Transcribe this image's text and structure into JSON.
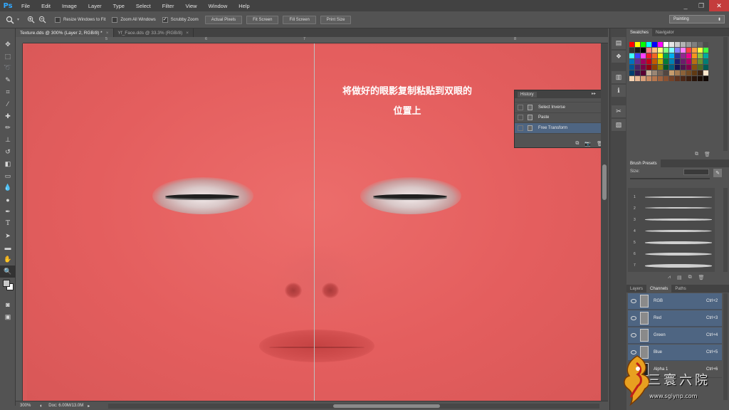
{
  "app": {
    "logo": "Ps"
  },
  "menu": [
    "File",
    "Edit",
    "Image",
    "Layer",
    "Type",
    "Select",
    "Filter",
    "View",
    "Window",
    "Help"
  ],
  "window_controls": [
    "_",
    "❐",
    "✕"
  ],
  "options": {
    "resize_windows_label": "Resize Windows to Fit",
    "zoom_all_label": "Zoom All Windows",
    "scrubby_label": "Scrubby Zoom",
    "actual_pixels": "Actual Pixels",
    "fit_screen": "Fit Screen",
    "fill_screen": "Fill Screen",
    "print_size": "Print Size",
    "workspace": "Painting"
  },
  "tabs": [
    {
      "label": "Texture.dds @ 300% (Layer 2, RGB/8) *"
    },
    {
      "label": "Yf_Face.dds @ 33.3% (RGB/8)"
    }
  ],
  "ruler": {
    "top_labels": [
      "5",
      "6",
      "7",
      "8"
    ]
  },
  "annotation": {
    "line1": "将做好的眼影复制粘贴到双眼的",
    "line2": "位置上"
  },
  "history": {
    "title": "History",
    "items": [
      {
        "label": "Select Inverse"
      },
      {
        "label": "Paste"
      },
      {
        "label": "Free Transform"
      }
    ],
    "selected_index": 2
  },
  "status": {
    "zoom": "300%",
    "doc": "Doc: 6.00M/13.0M"
  },
  "panels": {
    "swatches_tab": "Swatches",
    "navigator_tab": "Navigator",
    "brush_presets_title": "Brush Presets",
    "size_label": "Size:",
    "brush_numbers": [
      "1",
      "2",
      "3",
      "4",
      "5",
      "6",
      "7"
    ],
    "layers_tab": "Layers",
    "channels_tab": "Channels",
    "paths_tab": "Paths",
    "channels": [
      {
        "name": "RGB",
        "shortcut": "Ctrl+2"
      },
      {
        "name": "Red",
        "shortcut": "Ctrl+3"
      },
      {
        "name": "Green",
        "shortcut": "Ctrl+4"
      },
      {
        "name": "Blue",
        "shortcut": "Ctrl+5"
      },
      {
        "name": "Alpha 1",
        "shortcut": "Ctrl+6"
      }
    ]
  },
  "watermark": {
    "text": "三寰六院",
    "url": "www.sgiynp.com"
  },
  "colors": {
    "skin": "#e45e5e",
    "selection_blue": "#4e6582",
    "ps_blue": "#31a8ff"
  },
  "icons": {
    "zoom_in": "zoom-in-icon",
    "zoom_out": "zoom-out-icon",
    "new_state": "new-state-icon",
    "camera": "camera-icon",
    "trash": "trash-icon"
  }
}
